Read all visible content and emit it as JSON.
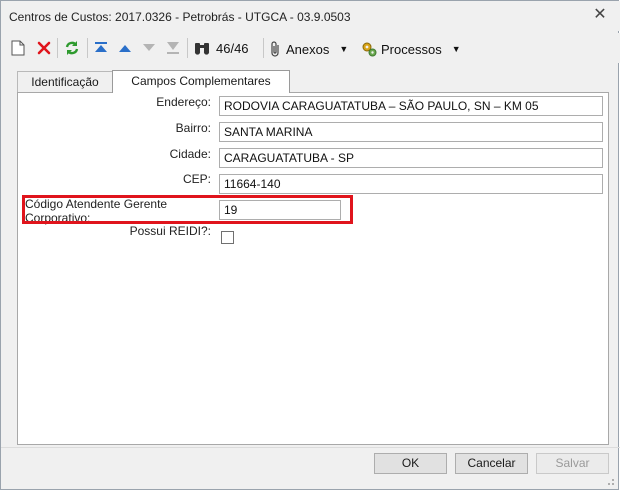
{
  "window": {
    "title": "Centros de Custos: 2017.0326 - Petrobrás - UTGCA - 03.9.0503"
  },
  "toolbar": {
    "record_counter": "46/46",
    "anexos_label": "Anexos",
    "processos_label": "Processos"
  },
  "tabs": [
    {
      "label": "Identificação"
    },
    {
      "label": "Campos Complementares"
    }
  ],
  "form": {
    "endereco": {
      "label": "Endereço:",
      "value": "RODOVIA CARAGUATATUBA – SÃO PAULO, SN – KM 05"
    },
    "bairro": {
      "label": "Bairro:",
      "value": "SANTA MARINA"
    },
    "cidade": {
      "label": "Cidade:",
      "value": "CARAGUATATUBA - SP"
    },
    "cep": {
      "label": "CEP:",
      "value": "11664-140"
    },
    "codigo": {
      "label": "Código Atendente Gerente Corporativo:",
      "value": "19"
    },
    "reidi": {
      "label": "Possui REIDI?:",
      "checked": false
    }
  },
  "buttons": {
    "ok": "OK",
    "cancelar": "Cancelar",
    "salvar": "Salvar"
  },
  "colors": {
    "highlight": "#e0141c",
    "delete_icon": "#e0141c",
    "refresh_icon": "#2e9a2e",
    "nav_icon": "#2a6fc9"
  }
}
